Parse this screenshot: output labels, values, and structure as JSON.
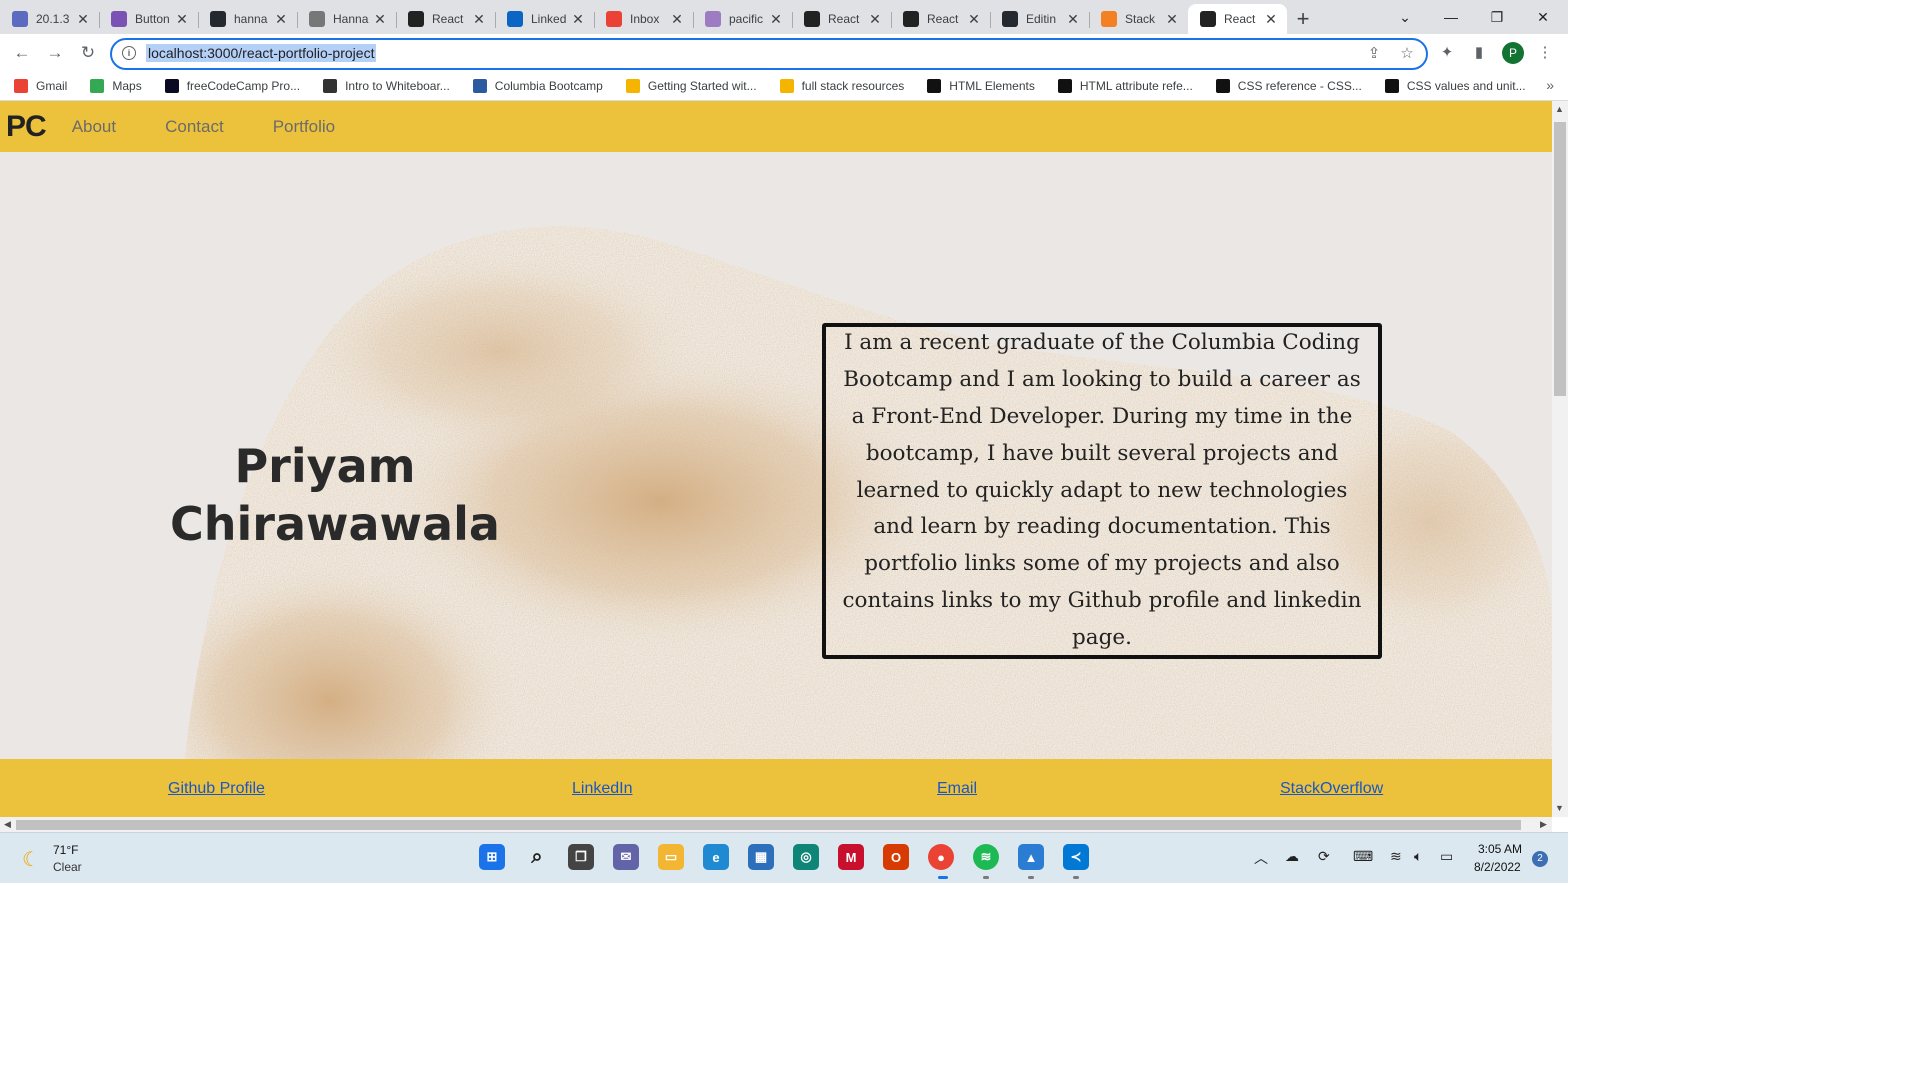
{
  "browser": {
    "tabs": [
      {
        "title": "20.1.3",
        "icon": "react-icon",
        "color": "#5c6bc0"
      },
      {
        "title": "Button",
        "icon": "bootstrap-icon",
        "color": "#7952b3"
      },
      {
        "title": "hanna",
        "icon": "github-icon",
        "color": "#24292f"
      },
      {
        "title": "Hanna",
        "icon": "avatar-icon",
        "color": "#777777"
      },
      {
        "title": "React",
        "icon": "react-icon",
        "color": "#222222"
      },
      {
        "title": "Linked",
        "icon": "linkedin-icon",
        "color": "#0a66c2"
      },
      {
        "title": "Inbox",
        "icon": "gmail-icon",
        "color": "#ea4335"
      },
      {
        "title": "pacific",
        "icon": "heroku-icon",
        "color": "#9e7cc1"
      },
      {
        "title": "React",
        "icon": "react-icon",
        "color": "#222222"
      },
      {
        "title": "React",
        "icon": "react-icon",
        "color": "#222222"
      },
      {
        "title": "Editin",
        "icon": "github-icon",
        "color": "#24292f"
      },
      {
        "title": "Stack",
        "icon": "stackoverflow-icon",
        "color": "#f48024"
      },
      {
        "title": "React",
        "icon": "react-icon",
        "color": "#222222",
        "active": true
      }
    ],
    "new_tab": "+",
    "url": "localhost:3000/react-portfolio-project",
    "profile_initial": "P",
    "bookmarks": [
      {
        "label": "Gmail",
        "icon": "gmail-icon",
        "color": "#ea4335"
      },
      {
        "label": "Maps",
        "icon": "maps-icon",
        "color": "#34a853"
      },
      {
        "label": "freeCodeCamp Pro...",
        "icon": "freecodecamp-icon",
        "color": "#0a0a23"
      },
      {
        "label": "Intro to Whiteboar...",
        "icon": "book-icon",
        "color": "#333333"
      },
      {
        "label": "Columbia Bootcamp",
        "icon": "columbia-icon",
        "color": "#2c5aa0"
      },
      {
        "label": "Getting Started wit...",
        "icon": "fullstack-icon",
        "color": "#f4b400"
      },
      {
        "label": "full stack resources",
        "icon": "fullstack-icon",
        "color": "#f4b400"
      },
      {
        "label": "HTML Elements",
        "icon": "mdn-icon",
        "color": "#111111"
      },
      {
        "label": "HTML attribute refe...",
        "icon": "mdn-icon",
        "color": "#111111"
      },
      {
        "label": "CSS reference - CSS...",
        "icon": "mdn-icon",
        "color": "#111111"
      },
      {
        "label": "CSS values and unit...",
        "icon": "mdn-icon",
        "color": "#111111"
      }
    ],
    "bookmarks_more": "»"
  },
  "site": {
    "brand": "PC",
    "nav": [
      "About",
      "Contact",
      "Portfolio"
    ],
    "name": "Priyam Chirawawala",
    "about": "I am a recent graduate of the Columbia Coding Bootcamp and I am looking to build a career as a Front-End Developer. During my time in the bootcamp, I have built several projects and learned to quickly adapt to new technologies and learn by reading documentation. This portfolio links some of my projects and also contains links to my Github profile and linkedin page.",
    "footer_links": [
      "Github Profile",
      "LinkedIn",
      "Email",
      "StackOverflow"
    ],
    "accent": "#ecc23d"
  },
  "taskbar": {
    "weather_temp": "71°F",
    "weather_desc": "Clear",
    "time": "3:05 AM",
    "date": "8/2/2022",
    "notifications": "2"
  }
}
